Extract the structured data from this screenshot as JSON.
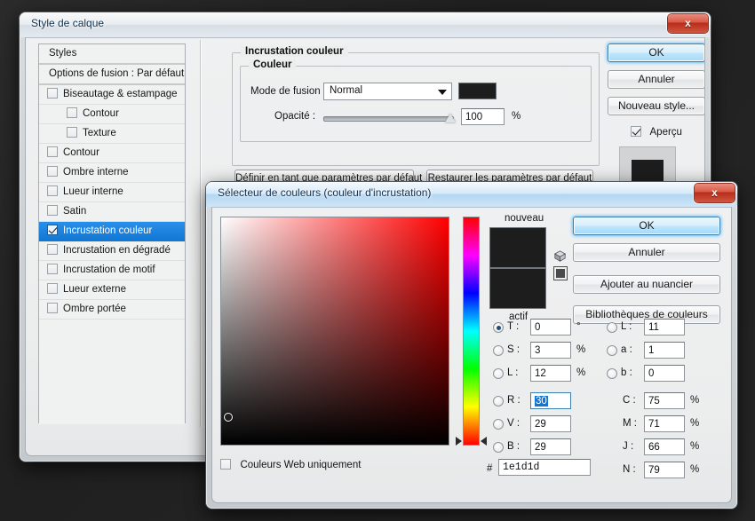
{
  "desktop": {
    "background_color": "#262626"
  },
  "layer_style": {
    "title": "Style de calque",
    "close_label": "x",
    "list": [
      {
        "label": "Styles",
        "type": "header",
        "checked": false,
        "indent": 0,
        "selected": false
      },
      {
        "label": "Options de fusion : Par défaut",
        "type": "header2",
        "checked": false,
        "indent": 0,
        "selected": false
      },
      {
        "label": "Biseautage & estampage",
        "type": "item",
        "checked": false,
        "indent": 0,
        "selected": false
      },
      {
        "label": "Contour",
        "type": "item",
        "checked": false,
        "indent": 1,
        "selected": false
      },
      {
        "label": "Texture",
        "type": "item",
        "checked": false,
        "indent": 1,
        "selected": false
      },
      {
        "label": "Contour",
        "type": "item",
        "checked": false,
        "indent": 0,
        "selected": false
      },
      {
        "label": "Ombre interne",
        "type": "item",
        "checked": false,
        "indent": 0,
        "selected": false
      },
      {
        "label": "Lueur interne",
        "type": "item",
        "checked": false,
        "indent": 0,
        "selected": false
      },
      {
        "label": "Satin",
        "type": "item",
        "checked": false,
        "indent": 0,
        "selected": false
      },
      {
        "label": "Incrustation couleur",
        "type": "item",
        "checked": true,
        "indent": 0,
        "selected": true
      },
      {
        "label": "Incrustation en dégradé",
        "type": "item",
        "checked": false,
        "indent": 0,
        "selected": false
      },
      {
        "label": "Incrustation de motif",
        "type": "item",
        "checked": false,
        "indent": 0,
        "selected": false
      },
      {
        "label": "Lueur externe",
        "type": "item",
        "checked": false,
        "indent": 0,
        "selected": false
      },
      {
        "label": "Ombre portée",
        "type": "item",
        "checked": false,
        "indent": 0,
        "selected": false
      }
    ],
    "panel": {
      "group_title": "Incrustation couleur",
      "subgroup_title": "Couleur",
      "blend_mode_label": "Mode de fusion :",
      "blend_mode_value": "Normal",
      "blend_color_swatch": "#1e1d1d",
      "opacity_label": "Opacité :",
      "opacity_value": "100",
      "opacity_unit": "%",
      "set_default_button": "Définir en tant que paramètres par défaut",
      "restore_default_button": "Restaurer les paramètres par défaut"
    },
    "buttons": {
      "ok": "OK",
      "cancel": "Annuler",
      "new_style": "Nouveau style...",
      "preview_label": "Aperçu",
      "preview_checked": true,
      "preview_swatch_color": "#1e1d1d"
    }
  },
  "color_picker": {
    "title": "Sélecteur de couleurs (couleur d'incrustation)",
    "close_label": "x",
    "new_label": "nouveau",
    "current_label": "actif",
    "new_color": "#1e1d1d",
    "current_color": "#1e1d1d",
    "buttons": {
      "ok": "OK",
      "cancel": "Annuler",
      "add_swatch": "Ajouter au nuancier",
      "libraries": "Bibliothèques de couleurs"
    },
    "web_only_label": "Couleurs Web uniquement",
    "web_only_checked": false,
    "hex_prefix": "#",
    "hex_value": "1e1d1d",
    "hsb": [
      {
        "name": "T",
        "label": "T :",
        "value": "0",
        "unit": "°",
        "selected": true
      },
      {
        "name": "S",
        "label": "S :",
        "value": "3",
        "unit": "%",
        "selected": false
      },
      {
        "name": "L",
        "label": "L :",
        "value": "12",
        "unit": "%",
        "selected": false
      }
    ],
    "rgb": [
      {
        "name": "R",
        "label": "R :",
        "value": "30",
        "unit": "",
        "selected": false,
        "focused": true
      },
      {
        "name": "V",
        "label": "V :",
        "value": "29",
        "unit": "",
        "selected": false,
        "focused": false
      },
      {
        "name": "B",
        "label": "B :",
        "value": "29",
        "unit": "",
        "selected": false,
        "focused": false
      }
    ],
    "lab": [
      {
        "name": "L",
        "label": "L :",
        "value": "11",
        "unit": "",
        "selected": false
      },
      {
        "name": "a",
        "label": "a :",
        "value": "1",
        "unit": "",
        "selected": false
      },
      {
        "name": "b",
        "label": "b :",
        "value": "0",
        "unit": "",
        "selected": false
      }
    ],
    "cmyk": [
      {
        "name": "C",
        "label": "C :",
        "value": "75",
        "unit": "%"
      },
      {
        "name": "M",
        "label": "M :",
        "value": "71",
        "unit": "%"
      },
      {
        "name": "J",
        "label": "J :",
        "value": "66",
        "unit": "%"
      },
      {
        "name": "N",
        "label": "N :",
        "value": "79",
        "unit": "%"
      }
    ],
    "field": {
      "hue": 0,
      "sat_pct": 3,
      "bright_pct": 12
    }
  }
}
